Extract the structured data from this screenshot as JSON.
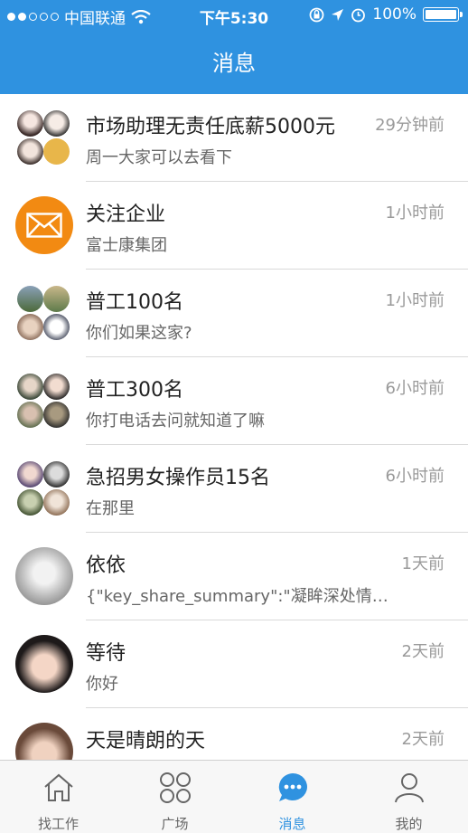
{
  "status_bar": {
    "carrier": "中国联通",
    "time": "下午5:30",
    "battery": "100%"
  },
  "header": {
    "title": "消息"
  },
  "messages": [
    {
      "name": "市场助理无责任底薪5000元",
      "preview": "周一大家可以去看下",
      "time": "29分钟前",
      "avatar": "group-avatar"
    },
    {
      "name": "关注企业",
      "preview": "富士康集团",
      "time": "1小时前",
      "avatar": "mail-icon"
    },
    {
      "name": "普工100名",
      "preview": "你们如果这家?",
      "time": "1小时前",
      "avatar": "group-avatar"
    },
    {
      "name": "普工300名",
      "preview": "你打电话去问就知道了嘛",
      "time": "6小时前",
      "avatar": "group-avatar"
    },
    {
      "name": "急招男女操作员15名",
      "preview": "在那里",
      "time": "6小时前",
      "avatar": "group-avatar"
    },
    {
      "name": "依依",
      "preview": "{\"key_share_summary\":\"凝眸深处情…",
      "time": "1天前",
      "avatar": "user-avatar"
    },
    {
      "name": "等待",
      "preview": "你好",
      "time": "2天前",
      "avatar": "user-avatar"
    },
    {
      "name": "天是晴朗的天",
      "preview": "",
      "time": "2天前",
      "avatar": "user-avatar"
    }
  ],
  "tabs": [
    {
      "label": "找工作",
      "icon": "house-icon",
      "active": false
    },
    {
      "label": "广场",
      "icon": "grid-icon",
      "active": false
    },
    {
      "label": "消息",
      "icon": "chat-bubble-icon",
      "active": true
    },
    {
      "label": "我的",
      "icon": "person-icon",
      "active": false
    }
  ],
  "colors": {
    "accent": "#2f92e0",
    "mail_orange": "#f28a12"
  }
}
